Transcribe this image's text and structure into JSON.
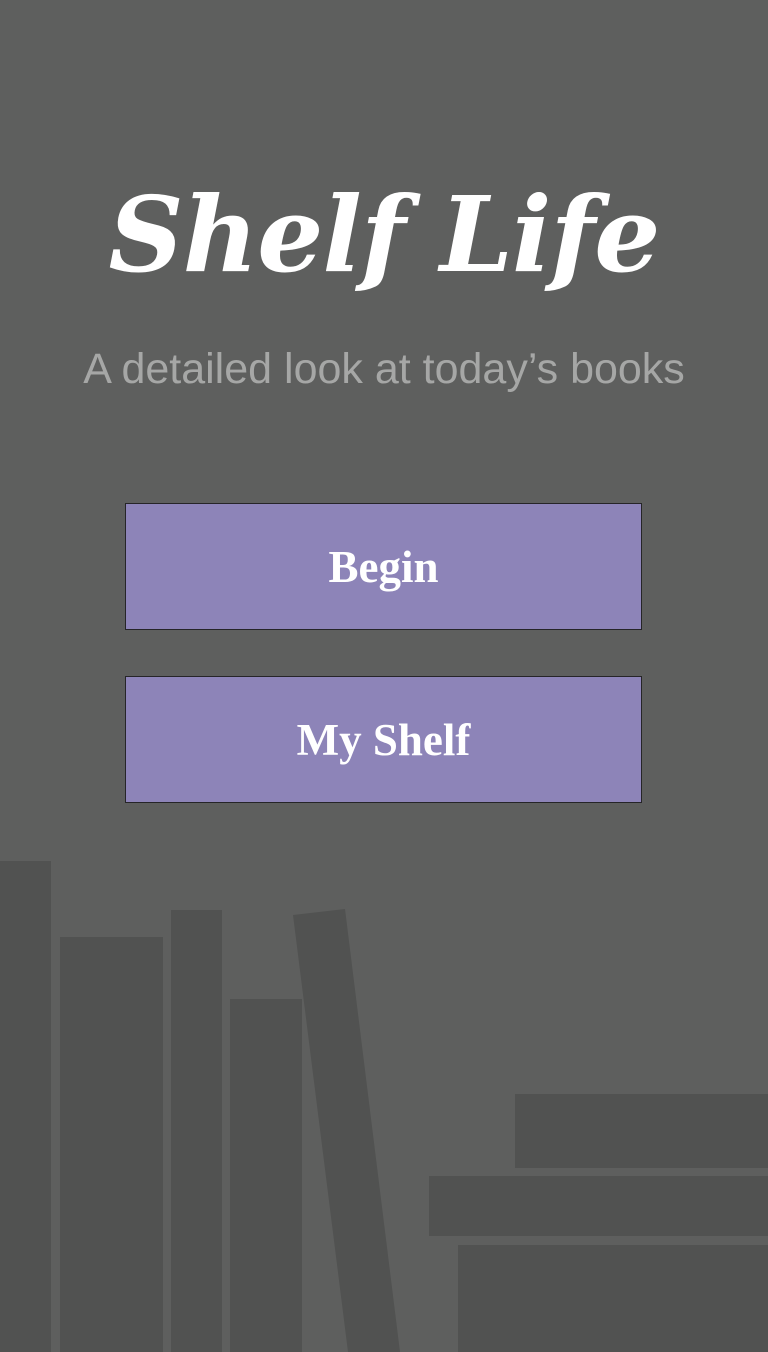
{
  "app": {
    "title": "Shelf Life",
    "subtitle": "A detailed look at today’s books"
  },
  "buttons": {
    "begin_label": "Begin",
    "my_shelf_label": "My Shelf"
  },
  "colors": {
    "background": "#5e5f5e",
    "book_silhouette": "#515251",
    "button_fill": "#8d84b8",
    "button_border": "#262528",
    "title_text": "#ffffff",
    "subtitle_text": "#a6a7a6"
  }
}
